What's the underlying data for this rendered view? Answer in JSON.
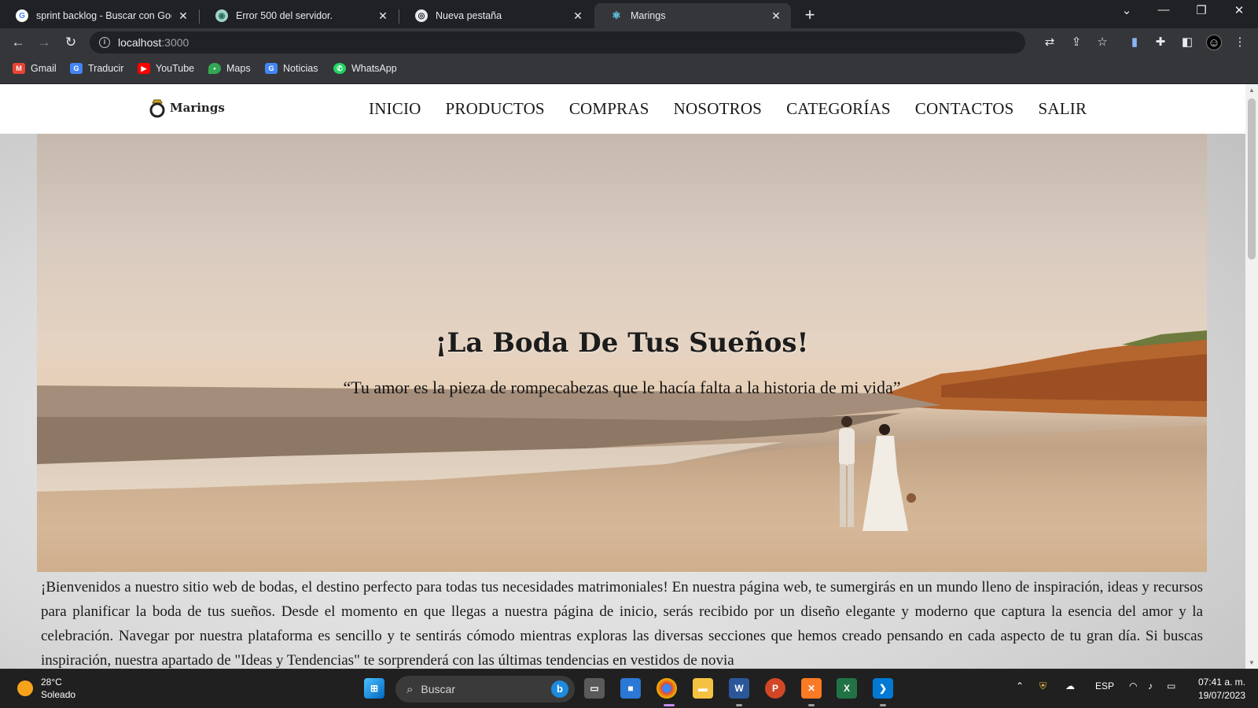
{
  "browser": {
    "tabs": [
      {
        "title": "sprint backlog - Buscar con Google",
        "favicon": "google-icon"
      },
      {
        "title": "Error 500 del servidor.",
        "favicon": "globe-icon"
      },
      {
        "title": "Nueva pestaña",
        "favicon": "chrome-icon"
      },
      {
        "title": "Marings",
        "favicon": "react-icon"
      }
    ],
    "address": {
      "host": "localhost",
      "port": ":3000"
    },
    "bookmarks": [
      {
        "label": "Gmail",
        "icon": "gmail-icon",
        "color": "#ea4335"
      },
      {
        "label": "Traducir",
        "icon": "translate-icon",
        "color": "#4285f4"
      },
      {
        "label": "YouTube",
        "icon": "youtube-icon",
        "color": "#ff0000"
      },
      {
        "label": "Maps",
        "icon": "maps-icon",
        "color": "#34a853"
      },
      {
        "label": "Noticias",
        "icon": "news-icon",
        "color": "#4285f4"
      },
      {
        "label": "WhatsApp",
        "icon": "whatsapp-icon",
        "color": "#25d366"
      }
    ]
  },
  "site": {
    "logo_text": "Marings",
    "menu": [
      "INICIO",
      "PRODUCTOS",
      "COMPRAS",
      "NOSOTROS",
      "CATEGORÍAS",
      "CONTACTOS",
      "SALIR"
    ],
    "hero_title": "¡La Boda De Tus Sueños!",
    "hero_quote": "“Tu amor es la pieza de rompecabezas que le hacía falta a la historia de mi vida”",
    "intro": "¡Bienvenidos a nuestro sitio web de bodas, el destino perfecto para todas tus necesidades matrimoniales! En nuestra página web, te sumergirás en un mundo lleno de inspiración, ideas y recursos para planificar la boda de tus sueños. Desde el momento en que llegas a nuestra página de inicio, serás recibido por un diseño elegante y moderno que captura la esencia del amor y la celebración. Navegar por nuestra plataforma es sencillo y te sentirás cómodo mientras exploras las diversas secciones que hemos creado pensando en cada aspecto de tu gran día. Si buscas inspiración, nuestra apartado de \"Ideas y Tendencias\" te sorprenderá con las últimas tendencias en vestidos de novia"
  },
  "taskbar": {
    "temperature": "28°C",
    "weather": "Soleado",
    "search_placeholder": "Buscar",
    "language": "ESP",
    "time": "07:41 a. m.",
    "date": "19/07/2023"
  }
}
